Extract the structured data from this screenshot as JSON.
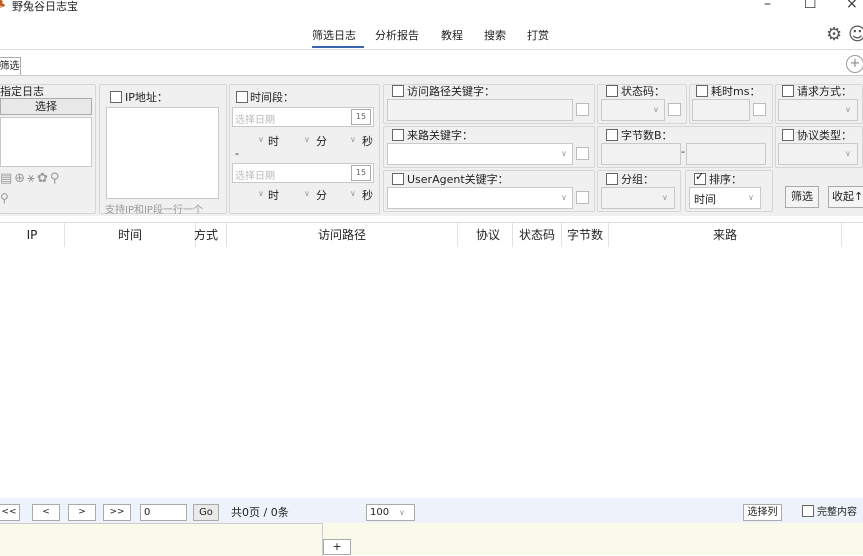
{
  "window": {
    "title": "野兔谷日志宝",
    "minimize": "–",
    "maximize": "☐",
    "close": "×"
  },
  "nav": {
    "items": [
      "筛选日志",
      "分析报告",
      "教程",
      "搜索",
      "打赏"
    ],
    "active": "筛选日志"
  },
  "tabs": {
    "filter": "筛选"
  },
  "filters": {
    "log": {
      "title": "指定日志",
      "select_button": "选择"
    },
    "ip": {
      "label": "IP地址：",
      "hint": "支持IP和IP段一行一个"
    },
    "time": {
      "label": "时间段：",
      "start_placeholder": "选择日期",
      "end_placeholder": "选择日期",
      "hour": "时",
      "minute": "分",
      "second": "秒",
      "separator": "-",
      "calendar_num": "15"
    },
    "path": {
      "label": "访问路径关键字："
    },
    "referer": {
      "label": "来路关键字："
    },
    "ua": {
      "label": "UserAgent关键字："
    },
    "status": {
      "label": "状态码："
    },
    "elapsed": {
      "label": "耗时ms："
    },
    "method": {
      "label": "请求方式："
    },
    "bytes": {
      "label": "字节数B：",
      "separator": "-"
    },
    "protocol": {
      "label": "协议类型："
    },
    "group": {
      "label": "分组："
    },
    "sort": {
      "label": "排序：",
      "value": "时间",
      "checked": true
    },
    "filter_button": "筛选",
    "collapse_button": "收起↑"
  },
  "table": {
    "columns": [
      "IP",
      "时间",
      "方式",
      "访问路径",
      "协议",
      "状态码",
      "字节数",
      "来路"
    ]
  },
  "pager": {
    "first": "<<",
    "prev": "<",
    "next": ">",
    "last": ">>",
    "page_input": "0",
    "go": "Go",
    "summary": "共0页 / 0条",
    "page_size": "100",
    "select_columns": "选择列",
    "full_content": "完整内容"
  },
  "bottom": {
    "add": "+"
  }
}
